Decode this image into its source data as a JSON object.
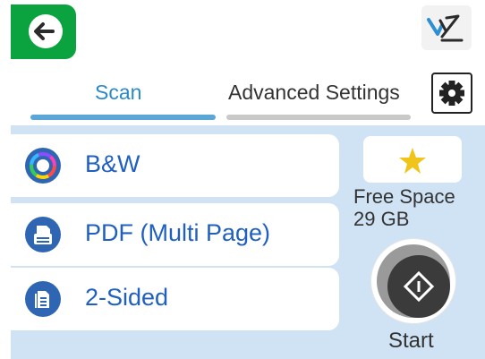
{
  "tabs": [
    {
      "label": "Scan"
    },
    {
      "label": "Advanced Settings"
    }
  ],
  "options": [
    {
      "label": "B&W",
      "icon": "color-mode-icon"
    },
    {
      "label": "PDF (Multi Page)",
      "icon": "file-format-icon"
    },
    {
      "label": "2-Sided",
      "icon": "two-sided-icon"
    }
  ],
  "storage": {
    "label": "Free Space",
    "value": "29 GB"
  },
  "start": {
    "label": "Start"
  },
  "colors": {
    "back": "#0aa33f",
    "accent": "#2a8ac9",
    "content_bg": "#cfe3f4",
    "option_text": "#1f5fbf",
    "star": "#f0c419"
  }
}
